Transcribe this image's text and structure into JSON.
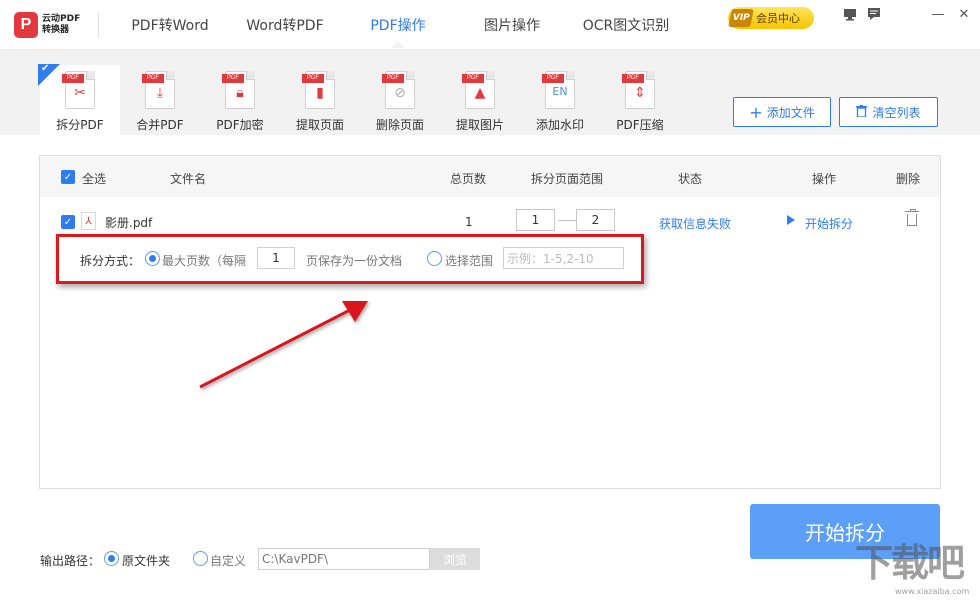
{
  "app": {
    "logo_mark": "P",
    "logo_line1": "云动PDF",
    "logo_line2": "转换器"
  },
  "nav": {
    "tabs": [
      "PDF转Word",
      "Word转PDF",
      "PDF操作",
      "图片操作",
      "OCR图文识别"
    ],
    "active": "PDF操作",
    "vip_tag": "VIP",
    "vip_label": "会员中心",
    "min_glyph": "—",
    "close_glyph": "✕"
  },
  "toolbar": {
    "tools": [
      {
        "label": "拆分PDF",
        "icon": "split-pdf-icon"
      },
      {
        "label": "合并PDF",
        "icon": "merge-pdf-icon"
      },
      {
        "label": "PDF加密",
        "icon": "encrypt-pdf-icon"
      },
      {
        "label": "提取页面",
        "icon": "extract-page-icon"
      },
      {
        "label": "删除页面",
        "icon": "delete-page-icon"
      },
      {
        "label": "提取图片",
        "icon": "extract-image-icon"
      },
      {
        "label": "添加水印",
        "icon": "watermark-icon"
      },
      {
        "label": "PDF压缩",
        "icon": "compress-pdf-icon"
      }
    ],
    "tag": "PDF",
    "add_file": "添加文件",
    "clear_list": "清空列表"
  },
  "table": {
    "headers": {
      "select_all": "全选",
      "filename": "文件名",
      "pages": "总页数",
      "range": "拆分页面范围",
      "status": "状态",
      "action": "操作",
      "delete": "删除"
    },
    "rows": [
      {
        "filename": "影册.pdf",
        "pages": "1",
        "range_from": "1",
        "range_to": "2",
        "status": "获取信息失败",
        "action": "开始拆分"
      }
    ],
    "split_mode": {
      "label": "拆分方式：",
      "option_max_pages": "最大页数（每隔",
      "max_pages_value": "1",
      "option_max_pages_suffix": "页保存为一份文档",
      "option_range": "选择范围",
      "range_placeholder": "示例：1-5,2-10"
    }
  },
  "output": {
    "label": "输出路径：",
    "option_original": "原文件夹",
    "option_custom": "自定义",
    "path": "C:\\KavPDF\\",
    "browse": "浏览"
  },
  "start_button": "开始拆分",
  "watermark": {
    "text": "下载吧",
    "url": "www.xiazaiba.com"
  },
  "colors": {
    "accent": "#2d7cf1",
    "brand_red": "#e4393c",
    "annotation_red": "#d9191c",
    "start_button": "#5b9ff8"
  }
}
